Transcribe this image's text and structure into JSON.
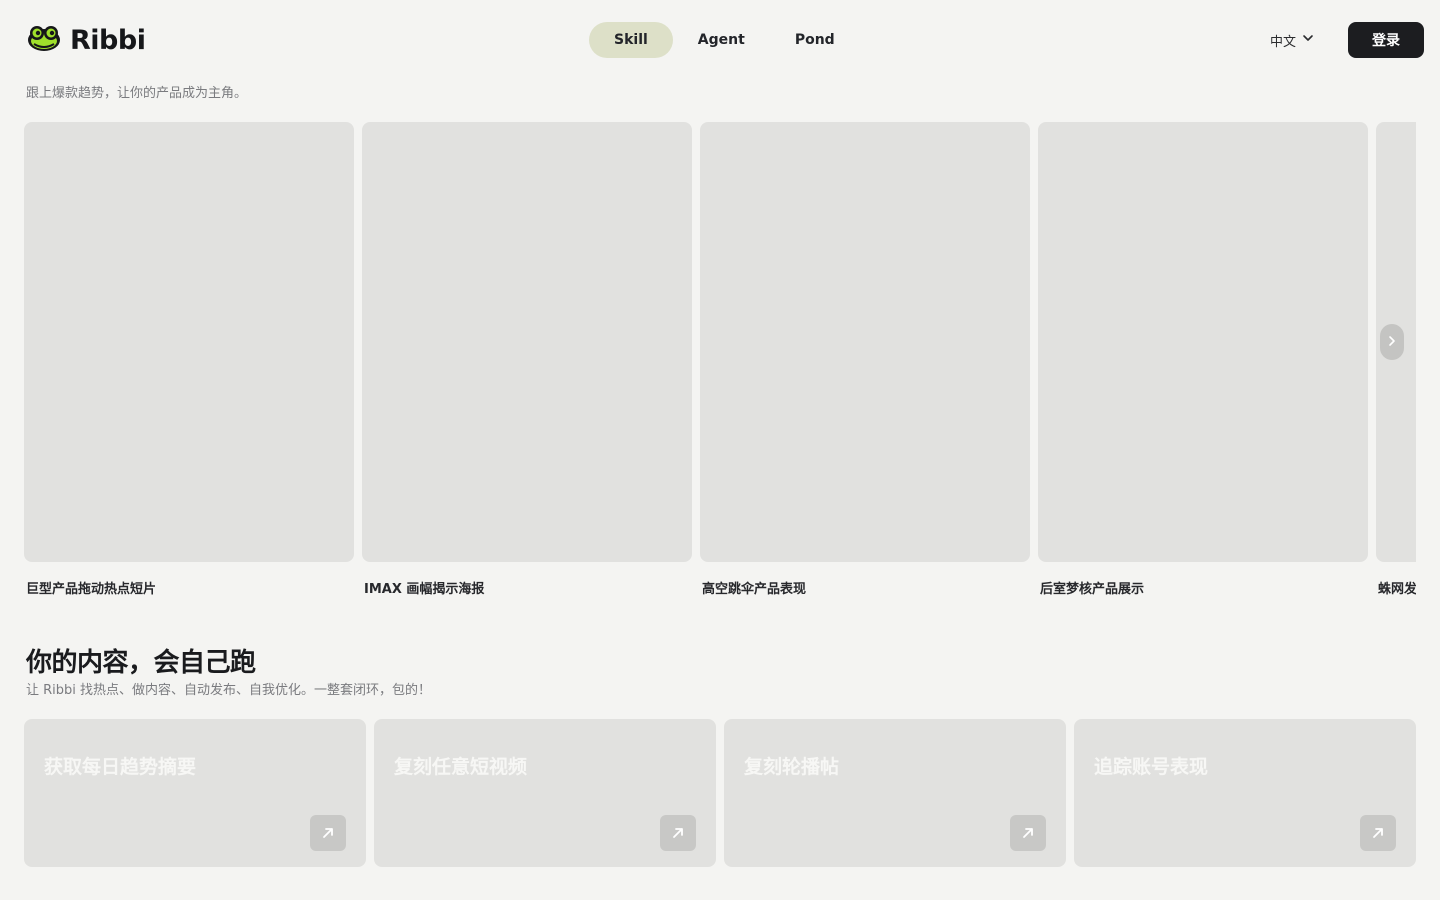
{
  "header": {
    "logo_text": "Ribbi",
    "nav": [
      {
        "label": "Skill",
        "active": true
      },
      {
        "label": "Agent",
        "active": false
      },
      {
        "label": "Pond",
        "active": false
      }
    ],
    "language": "中文",
    "login_label": "登录"
  },
  "tagline": "跟上爆款趋势，让你的产品成为主角。",
  "carousel": {
    "cards": [
      {
        "title": "巨型产品拖动热点短片"
      },
      {
        "title": "IMAX 画幅揭示海报"
      },
      {
        "title": "高空跳伞产品表现"
      },
      {
        "title": "后室梦核产品展示"
      },
      {
        "title": "蛛网发"
      }
    ]
  },
  "section": {
    "title": "你的内容，会自己跑",
    "subtitle": "让 Ribbi 找热点、做内容、自动发布、自我优化。一整套闭环，包的！",
    "features": [
      {
        "title": "获取每日趋势摘要"
      },
      {
        "title": "复刻任意短视频"
      },
      {
        "title": "复刻轮播帖"
      },
      {
        "title": "追踪账号表现"
      }
    ]
  },
  "colors": {
    "background": "#f4f4f2",
    "nav_active": "#dde0c8",
    "primary_button": "#1c1d20",
    "card_placeholder": "#e1e1df",
    "logo_accent": "#9fe02b"
  },
  "icons": {
    "logo": "frog-logo-icon",
    "language_dropdown": "chevron-down-icon",
    "carousel_next": "chevron-right-icon",
    "feature_link": "arrow-up-right-icon"
  }
}
